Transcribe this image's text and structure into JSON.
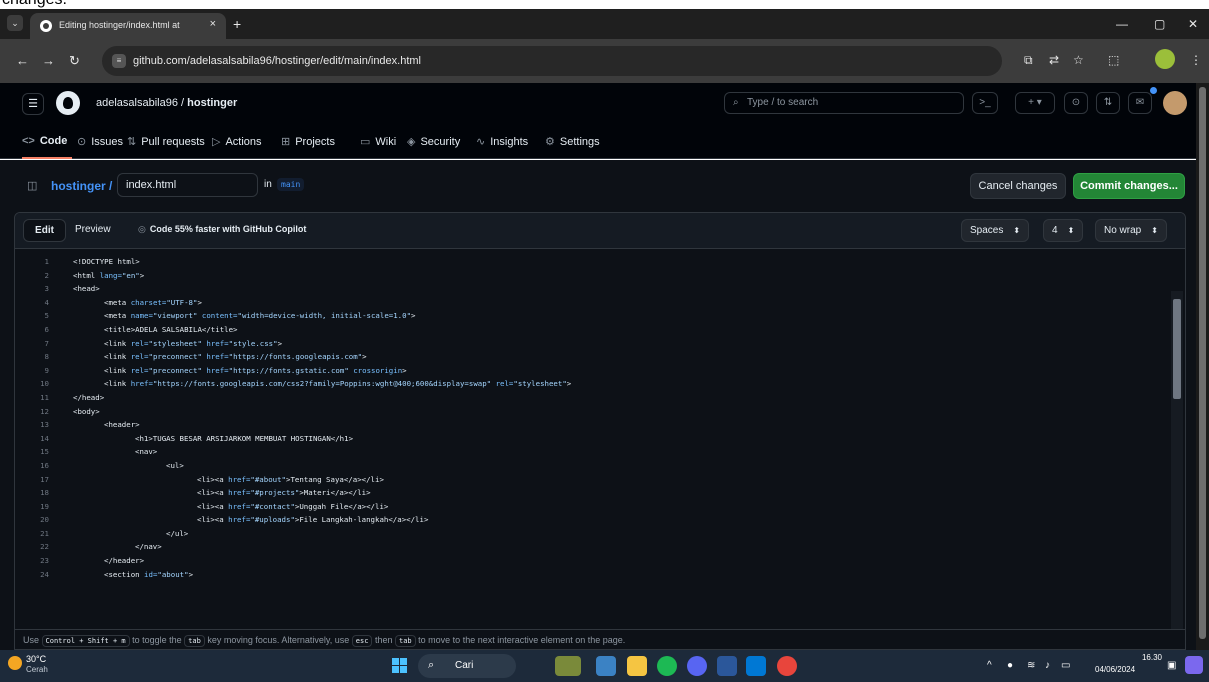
{
  "top_strip": {
    "text": "changes."
  },
  "browser": {
    "tab_title": "Editing hostinger/index.html at",
    "tab_close": "×",
    "new_tab": "+",
    "tab_menu": "⌄",
    "win_min": "—",
    "win_max": "▢",
    "win_close": "✕",
    "url": "github.com/adelasalsabila96/hostinger/edit/main/index.html",
    "site_icon": "≡"
  },
  "header": {
    "owner": "adelasalsabila96",
    "separator": "/",
    "repo": "hostinger",
    "search_placeholder": "Type / to search",
    "search_icon": "⌕"
  },
  "repo_nav": [
    {
      "icon": "<>",
      "label": "Code",
      "active": true
    },
    {
      "icon": "⊙",
      "label": "Issues"
    },
    {
      "icon": "⇅",
      "label": "Pull requests"
    },
    {
      "icon": "▷",
      "label": "Actions"
    },
    {
      "icon": "⊞",
      "label": "Projects"
    },
    {
      "icon": "▭",
      "label": "Wiki"
    },
    {
      "icon": "◈",
      "label": "Security"
    },
    {
      "icon": "∿",
      "label": "Insights"
    },
    {
      "icon": "⚙",
      "label": "Settings"
    }
  ],
  "edit": {
    "repo_crumb": "hostinger /",
    "filename": "index.html",
    "in_label": "in",
    "branch": "main",
    "cancel_label": "Cancel changes",
    "commit_label": "Commit changes...",
    "tab_edit": "Edit",
    "tab_preview": "Preview",
    "copilot_text": "Code 55% faster with GitHub Copilot",
    "indent_mode": "Spaces",
    "indent_size": "4",
    "wrap_mode": "No wrap"
  },
  "code": [
    {
      "n": "1",
      "indent": 0,
      "parts": [
        [
          "t",
          "<!DOCTYPE html>"
        ]
      ]
    },
    {
      "n": "2",
      "indent": 0,
      "parts": [
        [
          "t",
          "<html "
        ],
        [
          "a",
          "lang="
        ],
        [
          "s",
          "\"en\""
        ],
        [
          "t",
          ">"
        ]
      ]
    },
    {
      "n": "3",
      "indent": 0,
      "parts": [
        [
          "t",
          "<head>"
        ]
      ]
    },
    {
      "n": "4",
      "indent": 1,
      "parts": [
        [
          "t",
          "<meta "
        ],
        [
          "a",
          "charset="
        ],
        [
          "s",
          "\"UTF-8\""
        ],
        [
          "t",
          ">"
        ]
      ]
    },
    {
      "n": "5",
      "indent": 1,
      "parts": [
        [
          "t",
          "<meta "
        ],
        [
          "a",
          "name="
        ],
        [
          "s",
          "\"viewport\""
        ],
        [
          "a",
          " content="
        ],
        [
          "s",
          "\"width=device-width, initial-scale=1.0\""
        ],
        [
          "t",
          ">"
        ]
      ]
    },
    {
      "n": "6",
      "indent": 1,
      "parts": [
        [
          "t",
          "<title>ADELA SALSABILA</title>"
        ]
      ]
    },
    {
      "n": "7",
      "indent": 1,
      "parts": [
        [
          "t",
          "<link "
        ],
        [
          "a",
          "rel="
        ],
        [
          "s",
          "\"stylesheet\""
        ],
        [
          "a",
          " href="
        ],
        [
          "s",
          "\"style.css\""
        ],
        [
          "t",
          ">"
        ]
      ]
    },
    {
      "n": "8",
      "indent": 1,
      "parts": [
        [
          "t",
          "<link "
        ],
        [
          "a",
          "rel="
        ],
        [
          "s",
          "\"preconnect\""
        ],
        [
          "a",
          " href="
        ],
        [
          "s",
          "\"https://fonts.googleapis.com\""
        ],
        [
          "t",
          ">"
        ]
      ]
    },
    {
      "n": "9",
      "indent": 1,
      "parts": [
        [
          "t",
          "<link "
        ],
        [
          "a",
          "rel="
        ],
        [
          "s",
          "\"preconnect\""
        ],
        [
          "a",
          " href="
        ],
        [
          "s",
          "\"https://fonts.gstatic.com\""
        ],
        [
          "a",
          " crossorigin"
        ],
        [
          "t",
          ">"
        ]
      ]
    },
    {
      "n": "10",
      "indent": 1,
      "parts": [
        [
          "t",
          "<link "
        ],
        [
          "a",
          "href="
        ],
        [
          "s",
          "\"https://fonts.googleapis.com/css2?family=Poppins:wght@400;600&display=swap\""
        ],
        [
          "a",
          " rel="
        ],
        [
          "s",
          "\"stylesheet\""
        ],
        [
          "t",
          ">"
        ]
      ]
    },
    {
      "n": "11",
      "indent": 0,
      "parts": [
        [
          "t",
          "</head>"
        ]
      ]
    },
    {
      "n": "12",
      "indent": 0,
      "parts": [
        [
          "t",
          "<body>"
        ]
      ]
    },
    {
      "n": "13",
      "indent": 1,
      "parts": [
        [
          "t",
          "<header>"
        ]
      ]
    },
    {
      "n": "14",
      "indent": 2,
      "parts": [
        [
          "t",
          "<h1>TUGAS BESAR ARSIJARKOM MEMBUAT HOSTINGAN</h1>"
        ]
      ]
    },
    {
      "n": "15",
      "indent": 2,
      "parts": [
        [
          "t",
          "<nav>"
        ]
      ]
    },
    {
      "n": "16",
      "indent": 3,
      "parts": [
        [
          "t",
          "<ul>"
        ]
      ]
    },
    {
      "n": "17",
      "indent": 4,
      "parts": [
        [
          "t",
          "<li><a "
        ],
        [
          "a",
          "href="
        ],
        [
          "s",
          "\"#about\""
        ],
        [
          "t",
          ">Tentang Saya</a></li>"
        ]
      ]
    },
    {
      "n": "18",
      "indent": 4,
      "parts": [
        [
          "t",
          "<li><a "
        ],
        [
          "a",
          "href="
        ],
        [
          "s",
          "\"#projects\""
        ],
        [
          "t",
          ">Materi</a></li>"
        ]
      ]
    },
    {
      "n": "19",
      "indent": 4,
      "parts": [
        [
          "t",
          "<li><a "
        ],
        [
          "a",
          "href="
        ],
        [
          "s",
          "\"#contact\""
        ],
        [
          "t",
          ">Unggah File</a></li>"
        ]
      ]
    },
    {
      "n": "20",
      "indent": 4,
      "parts": [
        [
          "t",
          "<li><a "
        ],
        [
          "a",
          "href="
        ],
        [
          "s",
          "\"#uploads\""
        ],
        [
          "t",
          ">File Langkah-langkah</a></li>"
        ]
      ]
    },
    {
      "n": "21",
      "indent": 3,
      "parts": [
        [
          "t",
          "</ul>"
        ]
      ]
    },
    {
      "n": "22",
      "indent": 2,
      "parts": [
        [
          "t",
          "</nav>"
        ]
      ]
    },
    {
      "n": "23",
      "indent": 1,
      "parts": [
        [
          "t",
          "</header>"
        ]
      ]
    },
    {
      "n": "24",
      "indent": 1,
      "parts": [
        [
          "t",
          "<section "
        ],
        [
          "a",
          "id="
        ],
        [
          "s",
          "\"about\""
        ],
        [
          "t",
          ">"
        ]
      ]
    }
  ],
  "hint": {
    "p1": "Use",
    "k1": "Control + Shift + m",
    "p2": "to toggle the",
    "k2": "tab",
    "p3": "key moving focus. Alternatively, use",
    "k3": "esc",
    "p4": "then",
    "k4": "tab",
    "p5": "to move to the next interactive element on the page."
  },
  "taskbar": {
    "temp": "30°C",
    "weather": "Cerah",
    "search_label": "Cari",
    "search_icon": "⌕",
    "time": "16.30",
    "date": "04/06/2024"
  }
}
